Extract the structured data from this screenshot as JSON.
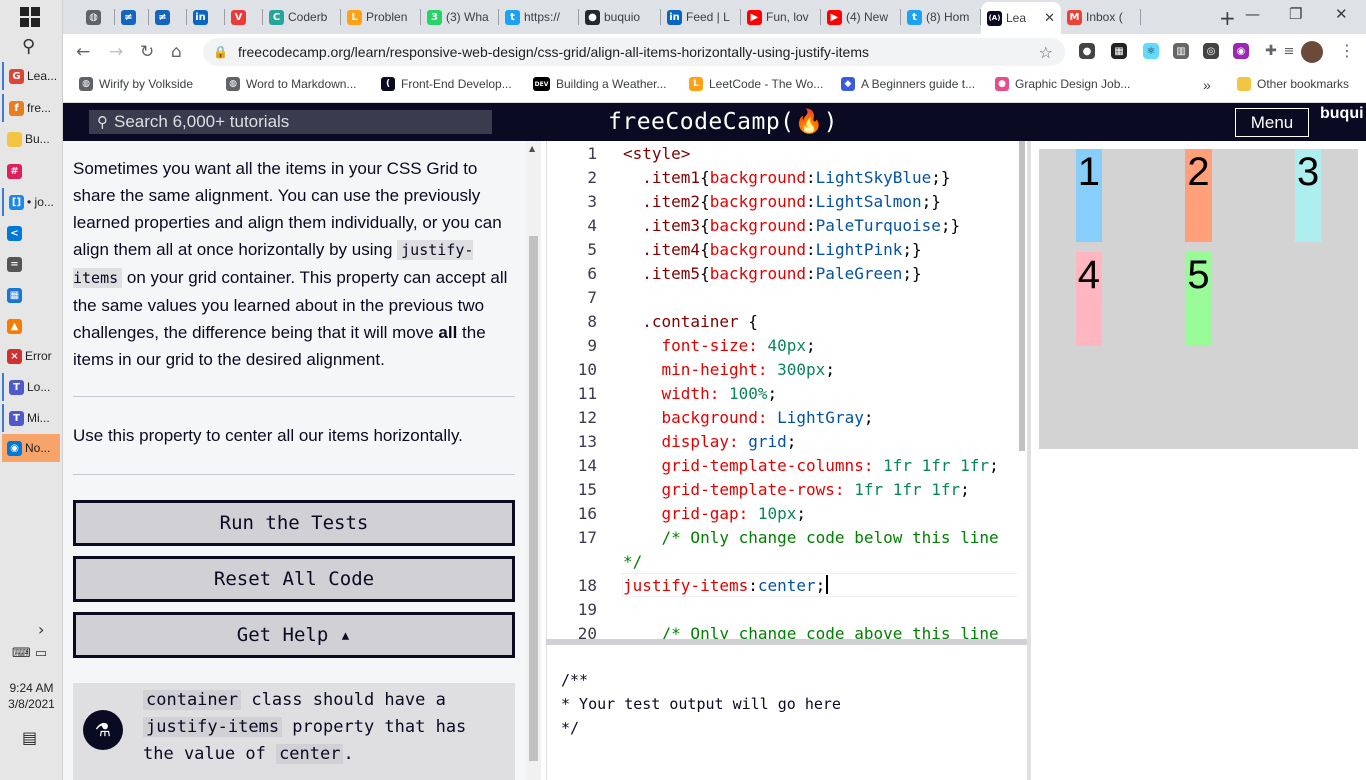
{
  "taskbar": {
    "apps": [
      {
        "label": "Lea...",
        "icon": "chrome-icon",
        "color": "#db4437",
        "glyph": "G"
      },
      {
        "label": "fre...",
        "icon": "chrome-profile-icon",
        "color": "#e67e22",
        "glyph": "f"
      },
      {
        "label": "Bu...",
        "icon": "folder-icon",
        "color": "#f4c542",
        "glyph": ""
      },
      {
        "label": "",
        "icon": "slack-icon",
        "color": "#e01e5a",
        "glyph": "#"
      },
      {
        "label": "• jo...",
        "icon": "window-icon",
        "color": "#1e88e5",
        "glyph": "[]"
      },
      {
        "label": "",
        "icon": "vscode-icon",
        "color": "#0078d7",
        "glyph": "<"
      },
      {
        "label": "",
        "icon": "calculator-icon",
        "color": "#555555",
        "glyph": "="
      },
      {
        "label": "",
        "icon": "calendar-icon",
        "color": "#1976d2",
        "glyph": "▦"
      },
      {
        "label": "",
        "icon": "vlc-icon",
        "color": "#f57c00",
        "glyph": "▲"
      },
      {
        "label": "Error",
        "icon": "error-icon",
        "color": "#d32f2f",
        "glyph": "×"
      },
      {
        "label": "Lo...",
        "icon": "teams-icon",
        "color": "#5059c9",
        "glyph": "T"
      },
      {
        "label": "Mi...",
        "icon": "teams-icon",
        "color": "#5059c9",
        "glyph": "T"
      },
      {
        "label": "No...",
        "icon": "notification-app-icon",
        "color": "#0078d7",
        "glyph": "◉"
      }
    ],
    "time": "9:24 AM",
    "date": "3/8/2021"
  },
  "tabs": [
    {
      "label": "",
      "icon": "globe-icon",
      "color": "#5f6368",
      "glyph": "◍"
    },
    {
      "label": "",
      "icon": "tab-icon",
      "color": "#1565c0",
      "glyph": "≠"
    },
    {
      "label": "",
      "icon": "tab-icon",
      "color": "#1565c0",
      "glyph": "≠"
    },
    {
      "label": "",
      "icon": "linkedin-icon",
      "color": "#0a66c2",
      "glyph": "in"
    },
    {
      "label": "",
      "icon": "vivaldi-icon",
      "color": "#ef3939",
      "glyph": "V"
    },
    {
      "label": "Coderb",
      "icon": "coderbyte-icon",
      "color": "#26a69a",
      "glyph": "C"
    },
    {
      "label": "Problen",
      "icon": "leetcode-icon",
      "color": "#ffa116",
      "glyph": "L"
    },
    {
      "label": "(3) Wha",
      "icon": "whatsapp-icon",
      "color": "#25d366",
      "glyph": "3"
    },
    {
      "label": "https://",
      "icon": "twitter-icon",
      "color": "#1da1f2",
      "glyph": "t"
    },
    {
      "label": "buquio",
      "icon": "github-icon",
      "color": "#24292e",
      "glyph": "●"
    },
    {
      "label": "Feed | L",
      "icon": "linkedin-icon",
      "color": "#0a66c2",
      "glyph": "in"
    },
    {
      "label": "Fun, lov",
      "icon": "youtube-icon",
      "color": "#ff0000",
      "glyph": "▶"
    },
    {
      "label": "(4) New",
      "icon": "youtube-icon",
      "color": "#ff0000",
      "glyph": "▶"
    },
    {
      "label": "(8) Hom",
      "icon": "twitter-icon",
      "color": "#1da1f2",
      "glyph": "t"
    },
    {
      "label": "Lea",
      "icon": "freecodecamp-icon",
      "color": "#0a0a23",
      "glyph": "(A)",
      "active": true
    },
    {
      "label": "Inbox (",
      "icon": "gmail-icon",
      "color": "#ea4335",
      "glyph": "M"
    }
  ],
  "address": {
    "url": "freecodecamp.org/learn/responsive-web-design/css-grid/align-all-items-horizontally-using-justify-items"
  },
  "bookmarks": [
    {
      "label": "Wirify by Volkside",
      "icon": "globe-icon",
      "color": "#5f6368",
      "glyph": "◍"
    },
    {
      "label": "Word to Markdown...",
      "icon": "globe-icon",
      "color": "#5f6368",
      "glyph": "◍"
    },
    {
      "label": "Front-End Develop...",
      "icon": "bookmark-icon",
      "color": "#0a0a23",
      "glyph": "("
    },
    {
      "label": "Building a Weather...",
      "icon": "dev-icon",
      "color": "#000000",
      "glyph": "DEV"
    },
    {
      "label": "LeetCode - The Wo...",
      "icon": "leetcode-icon",
      "color": "#ffa116",
      "glyph": "L"
    },
    {
      "label": "A Beginners guide t...",
      "icon": "bookmark-icon",
      "color": "#3b5bdb",
      "glyph": "◆"
    },
    {
      "label": "Graphic Design Job...",
      "icon": "dribbble-icon",
      "color": "#ea4c89",
      "glyph": "●"
    }
  ],
  "bookmarks_more": "»",
  "other_bookmarks": "Other bookmarks",
  "fcc": {
    "search_placeholder": "Search 6,000+ tutorials",
    "logo": "freeCodeCamp(🔥)",
    "menu": "Menu",
    "user_alt": "buqui avat"
  },
  "instructions": {
    "p1_a": "Sometimes you want all the items in your CSS Grid to share the same alignment. You can use the previously learned properties and align them individually, or you can align them all at once horizontally by using ",
    "p1_code": "justify-items",
    "p1_b": " on your grid container. This property can accept all the same values you learned about in the previous two challenges, the difference being that it will move ",
    "p1_bold": "all",
    "p1_c": " the items in our grid to the desired alignment.",
    "task": "Use this property to center all our items horizontally.",
    "run_tests": "Run the Tests",
    "reset": "Reset All Code",
    "get_help": "Get Help ▴",
    "test_code1": "container",
    "test_t1": " class should have a ",
    "test_code2": "justify-items",
    "test_t2": " property that has the value of ",
    "test_code3": "center",
    "test_t3": "."
  },
  "editor": {
    "lines": [
      {
        "n": "1",
        "html": "<span class='tk-tag'>&lt;style&gt;</span>"
      },
      {
        "n": "2",
        "html": "  <span class='tk-sel'>.item1</span><span class='tk-p'>{</span><span class='tk-prop'>background</span><span class='tk-p'>:</span><span class='tk-val'>LightSkyBlue</span><span class='tk-p'>;}</span>"
      },
      {
        "n": "3",
        "html": "  <span class='tk-sel'>.item2</span><span class='tk-p'>{</span><span class='tk-prop'>background</span><span class='tk-p'>:</span><span class='tk-val'>LightSalmon</span><span class='tk-p'>;}</span>"
      },
      {
        "n": "4",
        "html": "  <span class='tk-sel'>.item3</span><span class='tk-p'>{</span><span class='tk-prop'>background</span><span class='tk-p'>:</span><span class='tk-val'>PaleTurquoise</span><span class='tk-p'>;}</span>"
      },
      {
        "n": "5",
        "html": "  <span class='tk-sel'>.item4</span><span class='tk-p'>{</span><span class='tk-prop'>background</span><span class='tk-p'>:</span><span class='tk-val'>LightPink</span><span class='tk-p'>;}</span>"
      },
      {
        "n": "6",
        "html": "  <span class='tk-sel'>.item5</span><span class='tk-p'>{</span><span class='tk-prop'>background</span><span class='tk-p'>:</span><span class='tk-val'>PaleGreen</span><span class='tk-p'>;}</span>"
      },
      {
        "n": "7",
        "html": ""
      },
      {
        "n": "8",
        "html": "  <span class='tk-sel'>.container</span> <span class='tk-p'>{</span>"
      },
      {
        "n": "9",
        "html": "    <span class='tk-prop'>font-size:</span> <span class='tk-num'>40px</span><span class='tk-p'>;</span>"
      },
      {
        "n": "10",
        "html": "    <span class='tk-prop'>min-height:</span> <span class='tk-num'>300px</span><span class='tk-p'>;</span>"
      },
      {
        "n": "11",
        "html": "    <span class='tk-prop'>width:</span> <span class='tk-num'>100%</span><span class='tk-p'>;</span>"
      },
      {
        "n": "12",
        "html": "    <span class='tk-prop'>background:</span> <span class='tk-val'>LightGray</span><span class='tk-p'>;</span>"
      },
      {
        "n": "13",
        "html": "    <span class='tk-prop'>display:</span> <span class='tk-val'>grid</span><span class='tk-p'>;</span>"
      },
      {
        "n": "14",
        "html": "    <span class='tk-prop'>grid-template-columns:</span> <span class='tk-num'>1fr 1fr 1fr</span><span class='tk-p'>;</span>"
      },
      {
        "n": "15",
        "html": "    <span class='tk-prop'>grid-template-rows:</span> <span class='tk-num'>1fr 1fr 1fr</span><span class='tk-p'>;</span>"
      },
      {
        "n": "16",
        "html": "    <span class='tk-prop'>grid-gap:</span> <span class='tk-num'>10px</span><span class='tk-p'>;</span>"
      },
      {
        "n": "17",
        "html": "    <span class='tk-cm'>/* Only change code below this line</span>"
      },
      {
        "n": "",
        "html": "<span class='tk-cm'>*/</span>"
      },
      {
        "n": "18",
        "html": "<span class='tk-prop'>justify-items</span><span class='tk-p'>:</span><span class='tk-val'>center</span><span class='tk-p'>;</span><span class='caret'></span>"
      },
      {
        "n": "19",
        "html": ""
      },
      {
        "n": "20",
        "html": "    <span class='tk-cm'>/* Only change code above this line</span>"
      }
    ]
  },
  "console": {
    "text": "/**\n* Your test output will go here\n*/"
  },
  "preview": {
    "items": [
      {
        "label": "1",
        "color": "LightSkyBlue"
      },
      {
        "label": "2",
        "color": "LightSalmon"
      },
      {
        "label": "3",
        "color": "PaleTurquoise"
      },
      {
        "label": "4",
        "color": "LightPink"
      },
      {
        "label": "5",
        "color": "PaleGreen"
      }
    ]
  }
}
